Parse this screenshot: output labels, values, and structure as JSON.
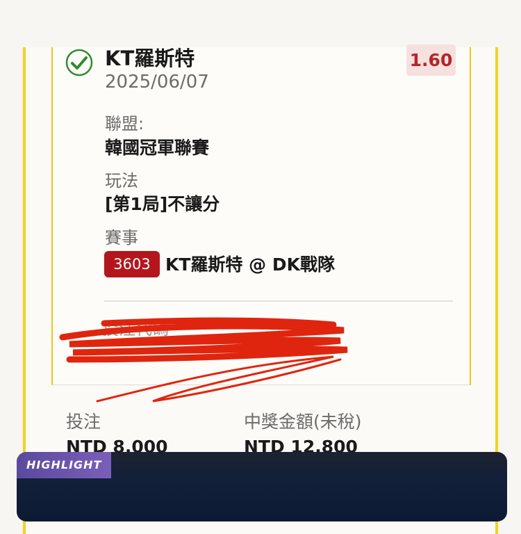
{
  "ticket": {
    "team": "KT羅斯特",
    "date": "2025/06/07",
    "odds": "1.60",
    "league_label": "聯盟:",
    "league_value": "韓國冠軍聯賽",
    "play_label": "玩法",
    "play_value": "[第1局]不讓分",
    "match_label": "賽事",
    "match_id": "3603",
    "match_value": "KT羅斯特 @ DK戰隊",
    "redacted_label": "投注代碼"
  },
  "summary": {
    "stake_label": "投注",
    "stake_value": "NTD 8,000",
    "payout_label": "中獎金額(未稅)",
    "payout_value": "NTD 12,800"
  },
  "video": {
    "tag": "HIGHLIGHT"
  },
  "colors": {
    "accent_yellow": "#f4d222",
    "odds_red": "#b3262a",
    "badge_red": "#b3161c",
    "check_green": "#2e8b2e",
    "scribble_red": "#e0250f"
  }
}
